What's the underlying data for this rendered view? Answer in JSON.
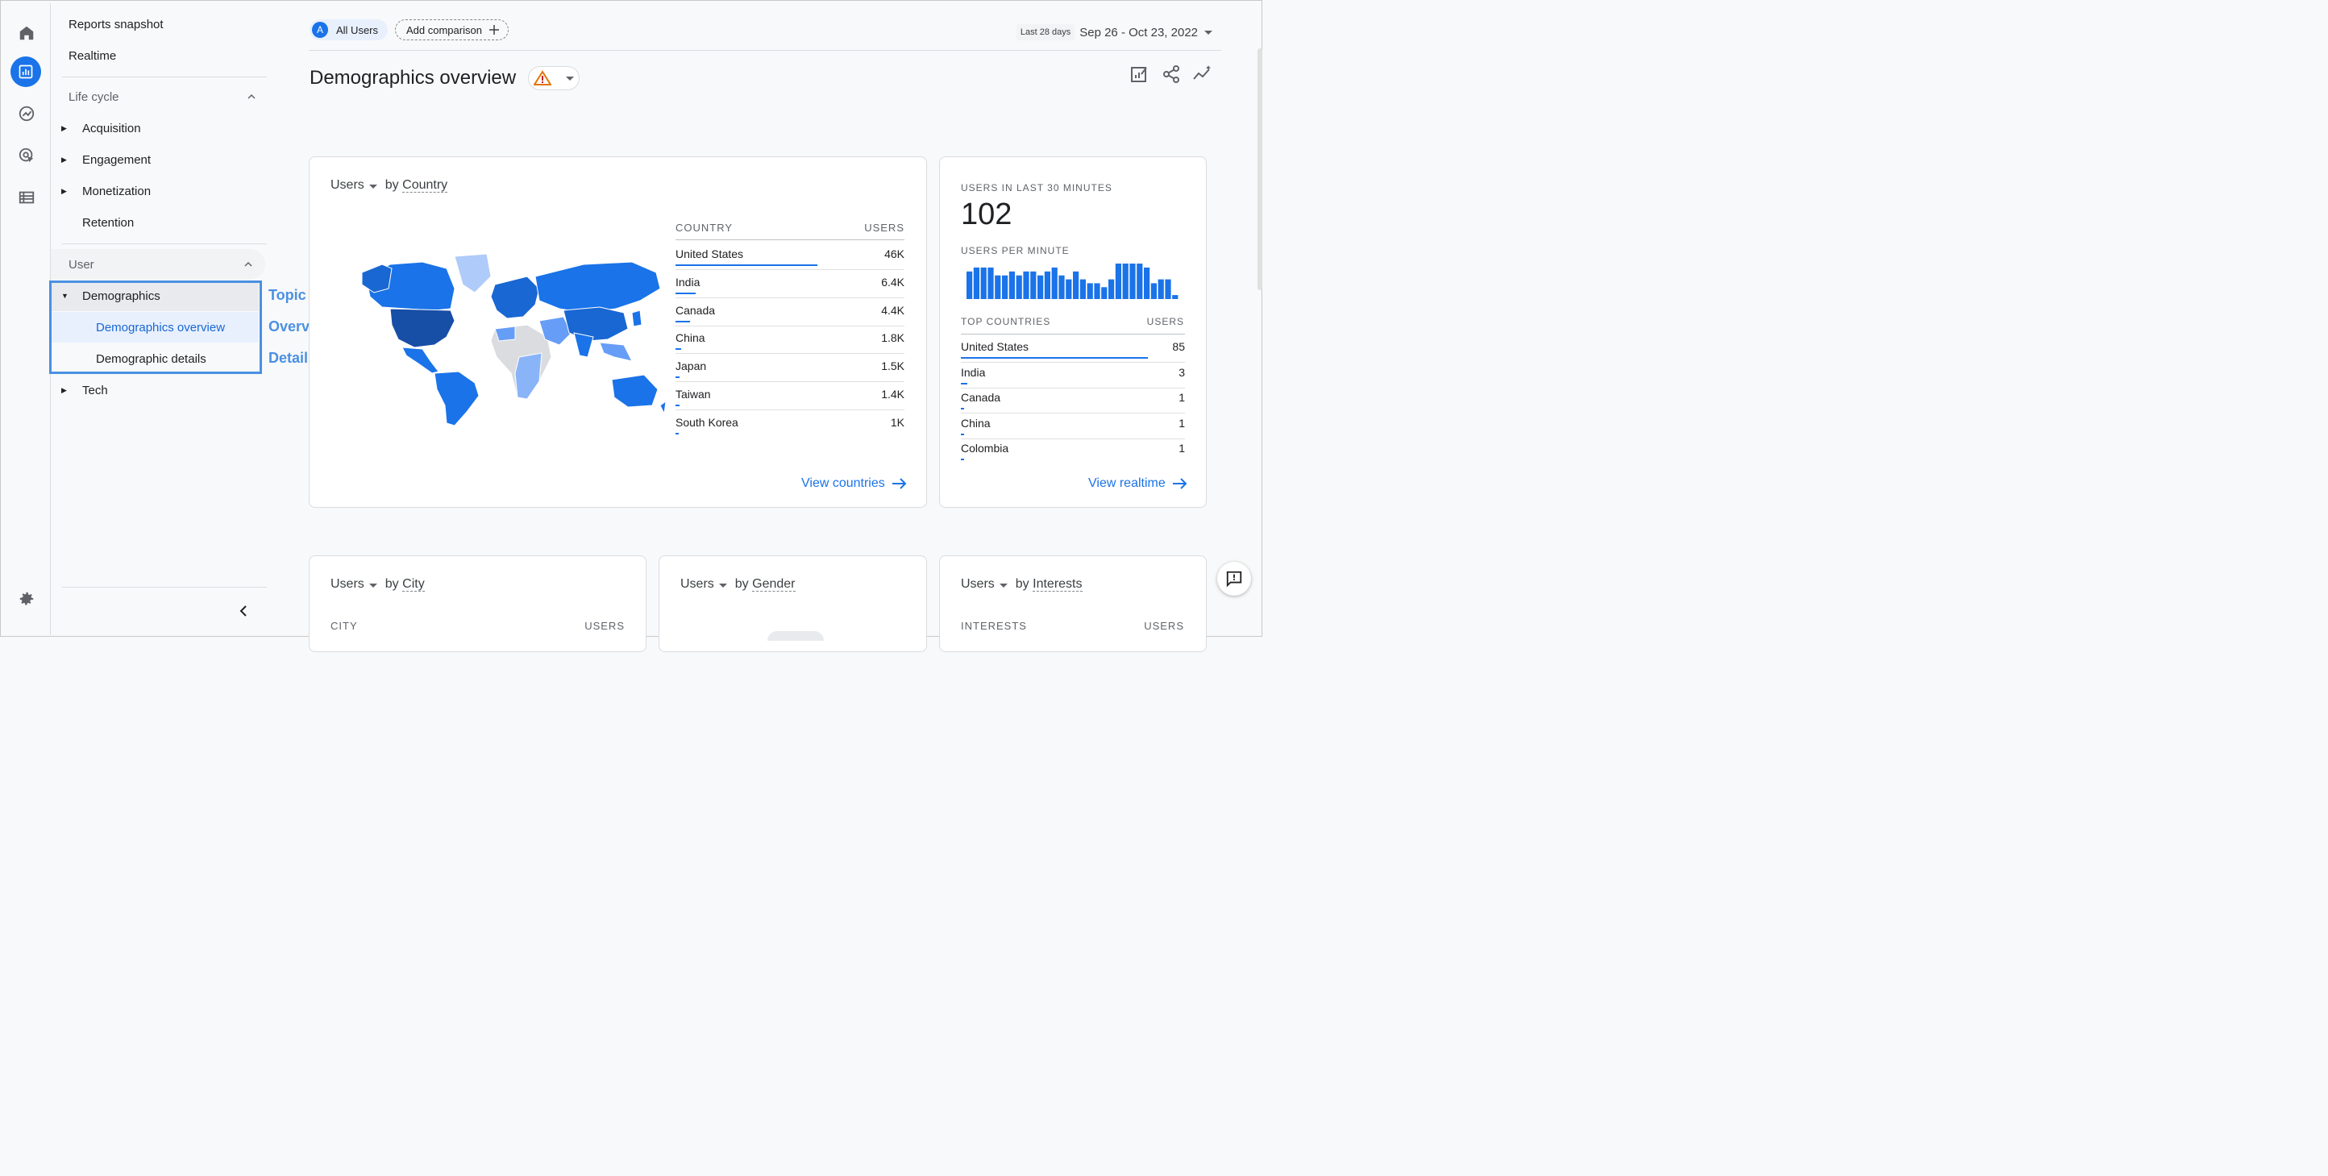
{
  "nav": {
    "reports_snapshot": "Reports snapshot",
    "realtime": "Realtime",
    "lifecycle": "Life cycle",
    "acquisition": "Acquisition",
    "engagement": "Engagement",
    "monetization": "Monetization",
    "retention": "Retention",
    "user": "User",
    "demographics": "Demographics",
    "demographics_overview": "Demographics overview",
    "demographic_details": "Demographic details",
    "tech": "Tech"
  },
  "annotations": {
    "topic": "Topic",
    "overview": "Overview report",
    "detail": "Detail report"
  },
  "header": {
    "segment_letter": "A",
    "segment_label": "All Users",
    "add_comparison": "Add comparison",
    "date_badge": "Last 28 days",
    "date_range": "Sep 26 - Oct 23, 2022",
    "title": "Demographics overview"
  },
  "country_card": {
    "metric": "Users",
    "by": "by",
    "dimension": "Country",
    "col_country": "COUNTRY",
    "col_users": "USERS",
    "rows": [
      {
        "name": "United States",
        "value": "46K",
        "share": 1.0
      },
      {
        "name": "India",
        "value": "6.4K",
        "share": 0.14
      },
      {
        "name": "Canada",
        "value": "4.4K",
        "share": 0.1
      },
      {
        "name": "China",
        "value": "1.8K",
        "share": 0.04
      },
      {
        "name": "Japan",
        "value": "1.5K",
        "share": 0.03
      },
      {
        "name": "Taiwan",
        "value": "1.4K",
        "share": 0.03
      },
      {
        "name": "South Korea",
        "value": "1K",
        "share": 0.02
      }
    ],
    "link": "View countries"
  },
  "realtime_card": {
    "label": "USERS IN LAST 30 MINUTES",
    "count": "102",
    "per_minute_label": "USERS PER MINUTE",
    "per_minute": [
      7,
      8,
      8,
      8,
      6,
      6,
      7,
      6,
      7,
      7,
      6,
      7,
      8,
      6,
      5,
      7,
      5,
      4,
      4,
      3,
      5,
      9,
      9,
      9,
      9,
      8,
      4,
      5,
      5,
      1
    ],
    "col_country": "TOP COUNTRIES",
    "col_users": "USERS",
    "rows": [
      {
        "name": "United States",
        "value": "85",
        "share": 1.0
      },
      {
        "name": "India",
        "value": "3",
        "share": 0.035
      },
      {
        "name": "Canada",
        "value": "1",
        "share": 0.012
      },
      {
        "name": "China",
        "value": "1",
        "share": 0.012
      },
      {
        "name": "Colombia",
        "value": "1",
        "share": 0.012
      }
    ],
    "link": "View realtime"
  },
  "city_card": {
    "metric": "Users",
    "by": "by",
    "dimension": "City",
    "col_left": "CITY",
    "col_right": "USERS"
  },
  "gender_card": {
    "metric": "Users",
    "by": "by",
    "dimension": "Gender"
  },
  "interests_card": {
    "metric": "Users",
    "by": "by",
    "dimension": "Interests",
    "col_left": "INTERESTS",
    "col_right": "USERS"
  },
  "colors": {
    "accent": "#1a73e8",
    "annotation": "#4a90e2",
    "map_dark": "#174ea6",
    "map_mid": "#1a73e8",
    "map_light": "#8ab4f8"
  }
}
